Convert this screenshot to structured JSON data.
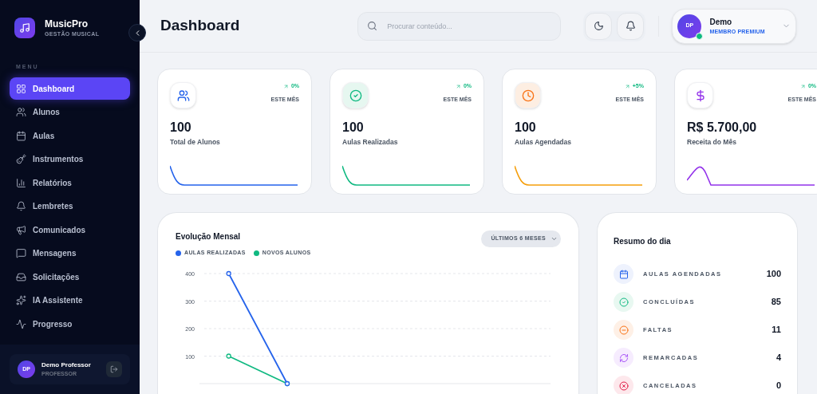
{
  "brand": {
    "name": "MusicPro",
    "subtitle": "GESTÃO MUSICAL"
  },
  "menu_label": "MENU",
  "sidebar": {
    "items": [
      {
        "label": "Dashboard",
        "selected": true
      },
      {
        "label": "Alunos",
        "selected": false
      },
      {
        "label": "Aulas",
        "selected": false
      },
      {
        "label": "Instrumentos",
        "selected": false
      },
      {
        "label": "Relatórios",
        "selected": false
      },
      {
        "label": "Lembretes",
        "selected": false
      },
      {
        "label": "Comunicados",
        "selected": false
      },
      {
        "label": "Mensagens",
        "selected": false
      },
      {
        "label": "Solicitações",
        "selected": false
      },
      {
        "label": "IA Assistente",
        "selected": false
      },
      {
        "label": "Progresso",
        "selected": false
      }
    ]
  },
  "sidebar_user": {
    "initials": "DP",
    "name": "Demo Professor",
    "role": "PROFESSOR"
  },
  "header": {
    "title": "Dashboard",
    "search": {
      "placeholder": "Procurar conteúdo..."
    },
    "user": {
      "initials": "DP",
      "name": "Demo",
      "plan": "MEMBRO PREMIUM"
    }
  },
  "stats": [
    {
      "value": "100",
      "label": "Total de Alunos",
      "trend": "0%",
      "period": "ESTE MÊS"
    },
    {
      "value": "100",
      "label": "Aulas Realizadas",
      "trend": "0%",
      "period": "ESTE MÊS"
    },
    {
      "value": "100",
      "label": "Aulas Agendadas",
      "trend": "+5%",
      "period": "ESTE MÊS"
    },
    {
      "value": "R$ 5.700,00",
      "label": "Receita do Mês",
      "trend": "0%",
      "period": "ESTE MÊS"
    }
  ],
  "evolution": {
    "title": "Evolução Mensal",
    "range": "ÚLTIMOS 6 MESES",
    "chart_data": {
      "type": "line",
      "ylim": [
        0,
        400
      ],
      "yticks": [
        100,
        200,
        300,
        400
      ],
      "grid": true,
      "series": [
        {
          "name": "AULAS REALIZADAS",
          "color": "#2563eb",
          "marker": "circle",
          "values": [
            400,
            0,
            null,
            null,
            null,
            null
          ]
        },
        {
          "name": "NOVOS ALUNOS",
          "color": "#10b981",
          "marker": "circle",
          "values": [
            100,
            0,
            null,
            null,
            null,
            null
          ]
        }
      ]
    }
  },
  "summary": {
    "title": "Resumo do dia",
    "items": [
      {
        "label": "AULAS AGENDADAS",
        "value": "100"
      },
      {
        "label": "CONCLUÍDAS",
        "value": "85"
      },
      {
        "label": "FALTAS",
        "value": "11"
      },
      {
        "label": "REMARCADAS",
        "value": "4"
      },
      {
        "label": "CANCELADAS",
        "value": "0"
      }
    ]
  }
}
